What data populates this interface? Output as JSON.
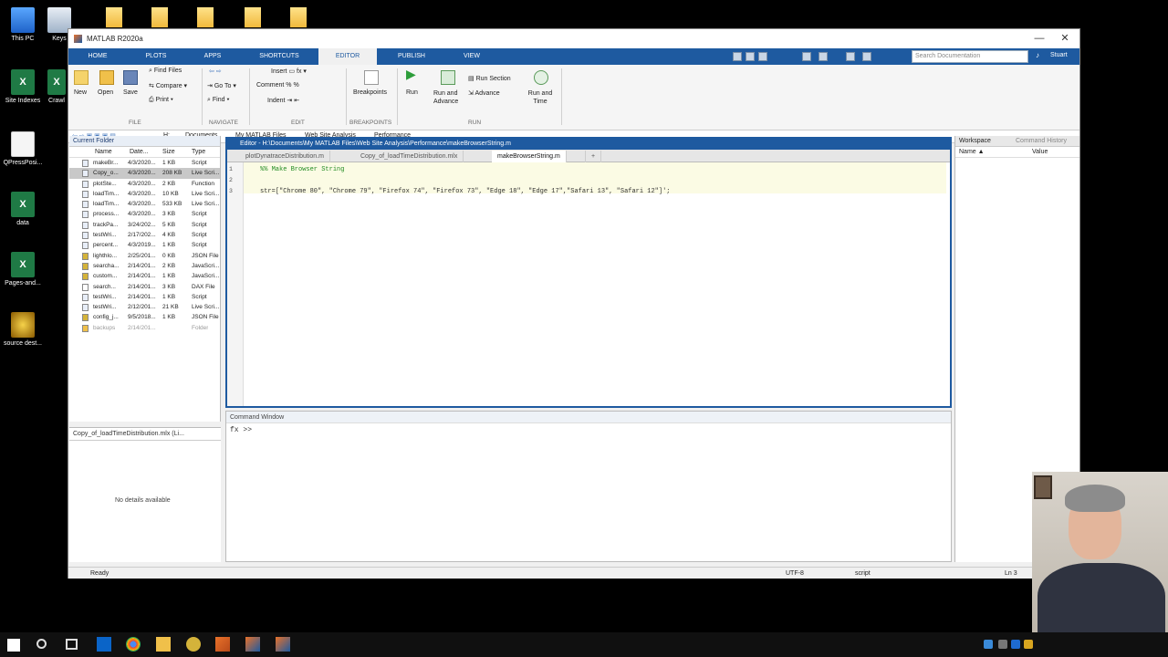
{
  "desktop": {
    "icons": [
      {
        "label": "This PC"
      },
      {
        "label": "Keys"
      },
      {
        "label": "Site Indexes"
      },
      {
        "label": "Crawl"
      },
      {
        "label": "QPressPosi..."
      },
      {
        "label": "data"
      },
      {
        "label": "Pages-and..."
      },
      {
        "label": "source dest..."
      }
    ]
  },
  "window": {
    "title": "MATLAB R2020a",
    "minimize": "—",
    "maximize": "☐",
    "close": "✕"
  },
  "ribbon_tabs": [
    "HOME",
    "PLOTS",
    "APPS",
    "SHORTCUTS",
    "EDITOR",
    "PUBLISH",
    "VIEW"
  ],
  "active_tab": "EDITOR",
  "search": {
    "placeholder": "Search Documentation"
  },
  "user": "Stuart",
  "ribbon": {
    "new": "New",
    "open": "Open",
    "save": "Save",
    "find_files": "Find Files",
    "compare": "Compare",
    "print": "Print",
    "go_to": "Go To",
    "find": "Find",
    "insert": "Insert",
    "comment": "Comment",
    "indent": "Indent",
    "breakpoints": "Breakpoints",
    "run": "Run",
    "run_and_advance": "Run and Advance",
    "run_section": "Run Section",
    "advance": "Advance",
    "run_and_time": "Run and Time",
    "sections": [
      "FILE",
      "NAVIGATE",
      "EDIT",
      "BREAKPOINTS",
      "RUN"
    ]
  },
  "address": {
    "crumbs": [
      "H:",
      "Documents",
      "My MATLAB Files",
      "Web Site Analysis",
      "Performance"
    ]
  },
  "current_folder": {
    "title": "Current Folder",
    "columns": [
      "Name",
      "Date...",
      "Size",
      "Type"
    ],
    "rows": [
      {
        "name": "makeBr...",
        "date": "4/3/2020...",
        "size": "1 KB",
        "type": "Script"
      },
      {
        "name": "Copy_o...",
        "date": "4/3/2020...",
        "size": "208 KB",
        "type": "Live Scri..."
      },
      {
        "name": "plotSte...",
        "date": "4/3/2020...",
        "size": "2 KB",
        "type": "Function"
      },
      {
        "name": "loadTim...",
        "date": "4/3/2020...",
        "size": "10 KB",
        "type": "Live Scri..."
      },
      {
        "name": "loadTim...",
        "date": "4/3/2020...",
        "size": "533 KB",
        "type": "Live Scri..."
      },
      {
        "name": "process...",
        "date": "4/3/2020...",
        "size": "3 KB",
        "type": "Script"
      },
      {
        "name": "trackPa...",
        "date": "3/24/202...",
        "size": "5 KB",
        "type": "Script"
      },
      {
        "name": "testWri...",
        "date": "2/17/202...",
        "size": "4 KB",
        "type": "Script"
      },
      {
        "name": "percent...",
        "date": "4/3/2019...",
        "size": "1 KB",
        "type": "Script"
      },
      {
        "name": "lighthlo...",
        "date": "2/25/201...",
        "size": "0 KB",
        "type": "JSON File"
      },
      {
        "name": "searcha...",
        "date": "2/14/201...",
        "size": "2 KB",
        "type": "JavaScri..."
      },
      {
        "name": "custom...",
        "date": "2/14/201...",
        "size": "1 KB",
        "type": "JavaScri..."
      },
      {
        "name": "search...",
        "date": "2/14/201...",
        "size": "3 KB",
        "type": "DAX File"
      },
      {
        "name": "testWri...",
        "date": "2/14/201...",
        "size": "1 KB",
        "type": "Script"
      },
      {
        "name": "testWri...",
        "date": "2/12/201...",
        "size": "21 KB",
        "type": "Live Scri..."
      },
      {
        "name": "config_j...",
        "date": "9/5/2018...",
        "size": "1 KB",
        "type": "JSON File"
      },
      {
        "name": "backups",
        "date": "2/14/201...",
        "size": "",
        "type": "Folder"
      }
    ]
  },
  "details": {
    "file": "Copy_of_loadTimeDistribution.mlx (Li...",
    "empty": "No details available"
  },
  "editor": {
    "title": "Editor - H:\\Documents\\My MATLAB Files\\Web Site Analysis\\Performance\\makeBrowserString.m",
    "tabs": [
      "plotDynatraceDistribution.m",
      "Copy_of_loadTimeDistribution.mlx",
      "makeBrowserString.m"
    ],
    "add_tab": "+",
    "lines": [
      {
        "n": "1",
        "text": "%% Make Browser String"
      },
      {
        "n": "2",
        "text": ""
      },
      {
        "n": "3",
        "text": "str=[\"Chrome 80\", \"Chrome 79\", \"Firefox 74\", \"Firefox 73\", \"Edge 18\", \"Edge 17\",\"Safari 13\", \"Safari 12\"]';"
      }
    ]
  },
  "command_window": {
    "title": "Command Window",
    "prompt": "fx >>"
  },
  "workspace": {
    "tabs": [
      "Workspace",
      "Command History"
    ],
    "columns": [
      "Name ▲",
      "Value"
    ]
  },
  "status": {
    "text": "Ready",
    "encoding": "UTF-8",
    "type": "script",
    "position": "Ln 3"
  },
  "colors": {
    "accent": "#1e5aa0",
    "ribbon_tab_bar": "#1e5aa0"
  }
}
